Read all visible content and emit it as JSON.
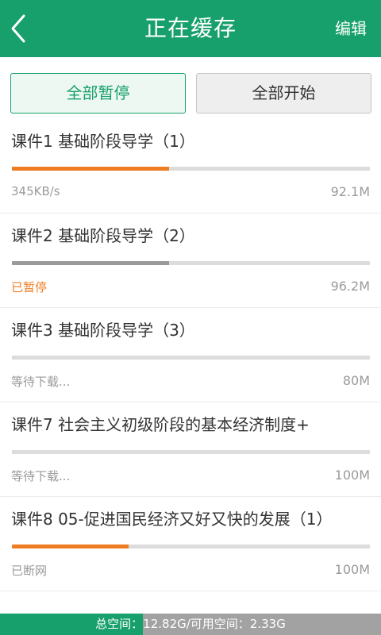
{
  "header": {
    "title": "正在缓存",
    "edit_label": "编辑",
    "back_icon": "back-arrow-icon",
    "color": "#17a06c"
  },
  "actions": {
    "pause_all_label": "全部暂停",
    "start_all_label": "全部开始"
  },
  "colors": {
    "accent": "#17a06c",
    "progress_active": "#ee7d22",
    "progress_paused": "#9a9a9a",
    "track": "#dcdcdc"
  },
  "items": [
    {
      "title": "课件1 基础阶段导学（1）",
      "status": "345KB/s",
      "status_type": "downloading",
      "size": "92.1M",
      "progress": 0.44
    },
    {
      "title": "课件2 基础阶段导学（2）",
      "status": "已暂停",
      "status_type": "paused",
      "size": "96.2M",
      "progress": 0.44
    },
    {
      "title": "课件3 基础阶段导学（3）",
      "status": "等待下载...",
      "status_type": "waiting",
      "size": "80M",
      "progress": 0
    },
    {
      "title": "课件7 社会主义初级阶段的基本经济制度+",
      "status": "等待下载...",
      "status_type": "waiting",
      "size": "100M",
      "progress": 0
    },
    {
      "title": "课件8 05-促进国民经济又好又快的发展（1）",
      "status": "已断网",
      "status_type": "offline",
      "size": "100M",
      "progress": 0.325
    }
  ],
  "storage": {
    "text": "总空间：12.82G/可用空间：2.33G",
    "used_fraction": 0.375
  }
}
